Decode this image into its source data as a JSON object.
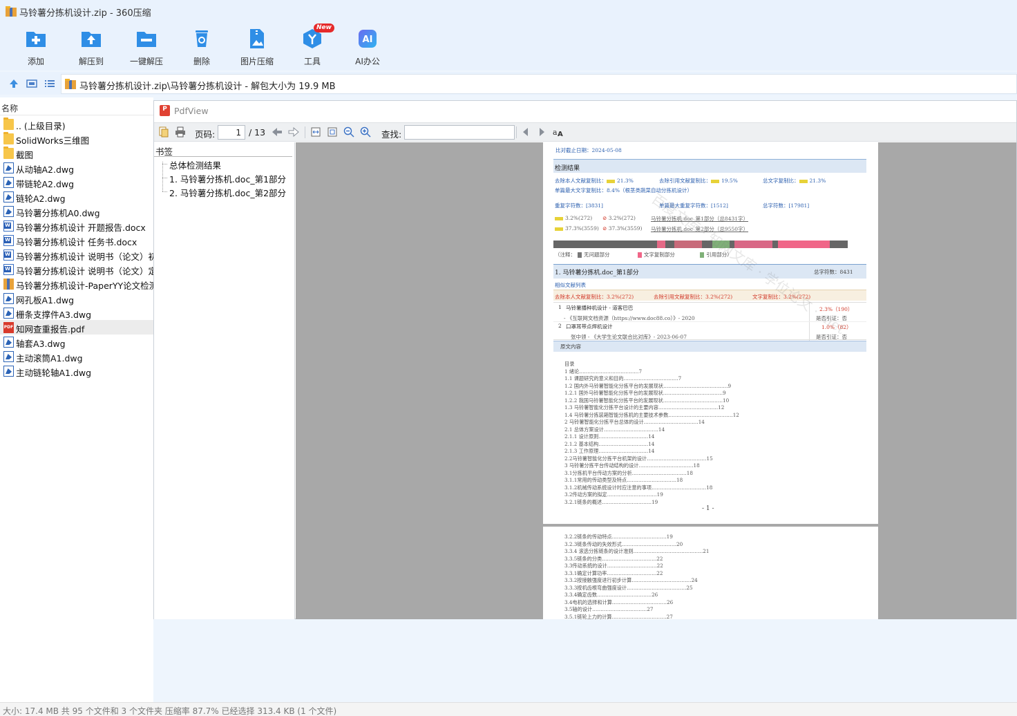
{
  "window": {
    "title": "马铃薯分拣机设计.zip - 360压缩"
  },
  "toolbar": {
    "buttons": [
      {
        "label": "添加",
        "icon": "add-icon"
      },
      {
        "label": "解压到",
        "icon": "extract-to-icon"
      },
      {
        "label": "一键解压",
        "icon": "one-click-extract-icon"
      },
      {
        "label": "删除",
        "icon": "delete-icon"
      },
      {
        "label": "图片压缩",
        "icon": "image-compress-icon"
      },
      {
        "label": "工具",
        "icon": "tools-icon",
        "badge": "New"
      },
      {
        "label": "AI办公",
        "icon": "ai-office-icon"
      }
    ]
  },
  "address": {
    "path": "马铃薯分拣机设计.zip\\马铃薯分拣机设计 - 解包大小为 19.9 MB"
  },
  "filelist": {
    "column_name": "名称",
    "items": [
      {
        "name": ".. (上级目录)",
        "type": "folder"
      },
      {
        "name": "SolidWorks三维图",
        "type": "folder"
      },
      {
        "name": "截图",
        "type": "folder"
      },
      {
        "name": "从动轴A2.dwg",
        "type": "dwg"
      },
      {
        "name": "带链轮A2.dwg",
        "type": "dwg"
      },
      {
        "name": "链轮A2.dwg",
        "type": "dwg"
      },
      {
        "name": "马铃薯分拣机A0.dwg",
        "type": "dwg"
      },
      {
        "name": "马铃薯分拣机设计 开题报告.docx",
        "type": "doc"
      },
      {
        "name": "马铃薯分拣机设计 任务书.docx",
        "type": "doc"
      },
      {
        "name": "马铃薯分拣机设计 说明书（论文）初稿",
        "type": "doc"
      },
      {
        "name": "马铃薯分拣机设计 说明书（论文）定稿",
        "type": "doc"
      },
      {
        "name": "马铃薯分拣机设计-PaperYY论文检测报告",
        "type": "zip"
      },
      {
        "name": "网孔板A1.dwg",
        "type": "dwg"
      },
      {
        "name": "栅条支撑件A3.dwg",
        "type": "dwg"
      },
      {
        "name": "知网查重报告.pdf",
        "type": "pdf",
        "selected": true
      },
      {
        "name": "轴套A3.dwg",
        "type": "dwg"
      },
      {
        "name": "主动滚筒A1.dwg",
        "type": "dwg"
      },
      {
        "name": "主动链轮轴A1.dwg",
        "type": "dwg"
      }
    ]
  },
  "pdfview": {
    "title": "PdfView",
    "page_label": "页码:",
    "page_current": "1",
    "page_total": "/ 13",
    "find_label": "查找:",
    "bookmarks_title": "书签",
    "bookmarks": [
      "总体检测结果",
      "1. 马铃薯分拣机.doc_第1部分",
      "2. 马铃薯分拣机.doc_第2部分"
    ]
  },
  "report": {
    "date": "比对截止日期：2024-05-08",
    "section_title": "检测结果",
    "stat1_label": "去除本人文献复制比：",
    "stat1_val": "21.3%",
    "stat2_label": "去除引用文献复制比：",
    "stat2_val": "19.5%",
    "stat3_label": "总文字复制比：",
    "stat3_val": "21.3%",
    "single_max": "单篇最大文字复制比：8.4%（根茎类蔬菜自动分拣机设计）",
    "dup_chars": "重复字符数：[3831]",
    "single_max_chars": "单篇最大重复字符数：[1512]",
    "total_chars": "总字符数：[17981]",
    "part_row1_a": "3.2%(272)",
    "part_row1_b": "3.2%(272)",
    "part_row1_name": "马铃薯分拣机.doc_第1部分（总8431字）",
    "part_row2_a": "37.3%(3559)",
    "part_row2_b": "37.3%(3559)",
    "part_row2_name": "马铃薯分拣机.doc_第2部分（总9550字）",
    "legend_note": "（注释：",
    "legend_none": "无问题部分",
    "legend_copy": "文字复制部分",
    "legend_cite": "引用部分）",
    "part1_title": "1.  马铃薯分拣机.doc_第1部分",
    "part1_total": "总字符数：8431",
    "similar_list": "相似文献列表",
    "part1_stat1": "去除本人文献复制比：3.2%(272)",
    "part1_stat2": "去除引用文献复制比：3.2%(272)",
    "part1_stat3": "文字复制比：3.2%(272)",
    "ref1_idx": "1",
    "ref1_title": "马铃薯播种机设计 - 道客巴巴",
    "ref1_pct": "2.3%（190）",
    "ref1_src": "-  《互联网文档资源（https://www.doc88.co）》-  2020",
    "ref1_cite": "是否引证：否",
    "ref2_idx": "2",
    "ref2_title": "口罩耳带点焊机设计",
    "ref2_pct": "1.0%（82）",
    "ref2_src": "张中领 -  《大学生论文联合比对库》- 2023-06-07",
    "ref2_cite": "是否引证：否",
    "original_text": "原文内容",
    "toc_page1": [
      "目录",
      "1 绪论………………………………7",
      "1.1 课题研究的意义和目的……………………………7",
      "1.2 国内外马铃薯智能化分拣平台的发展现状…………………………………9",
      "1.2.1 国外马铃薯智能化分拣平台的发展现状………………………………9",
      "1.2.2 我国马铃薯智能化分拣平台的发展现状………………………………10",
      "1.3 马铃薯智能化分拣平台设计的主要内容………………………………12",
      "1.4 马铃薯分拣装箱智能分拣机的主要技术参数…………………………………12",
      "2 马铃薯智能化分拣平台总体的设计……………………………14",
      "2.1 总体方案设计……………………………14",
      "2.1.1 设计原则…………………………14",
      "2.1.2 基本结构…………………………14",
      "2.1.3 工作原理…………………………14",
      "2.2马铃薯智能化分拣平台机架的设计………………………………15",
      "3 马铃薯分拣平台传动结构的设计……………………………18",
      "3.1分拣机平台传动方案的分析……………………………18",
      "3.1.1常用的传动类型及特点…………………………18",
      "3.1.2机械传动系统设计时应注意的事项……………………………18",
      "3.2传动方案的拟定…………………………19",
      "3.2.1链条的概述…………………………19"
    ],
    "page1_number": "- 1 -",
    "toc_page2": [
      "3.2.2链条的传动特点……………………………19",
      "3.2.3链条传动的失效形式……………………………20",
      "3.3.4 滚选分拣链条的设计准则……………………………………21",
      "3.3.5链条的分类……………………………22",
      "3.3传动系统的设计…………………………22",
      "3.3.1确定计算功率…………………………22",
      "3.3.2按接触强度进行初步计算………………………………24",
      "3.3.3按机齿根弯曲强度设计………………………………25",
      "3.3.4确定齿数……………………………26",
      "3.4电机的选择和计算……………………………26",
      "3.5轴的设计……………………………27",
      "3.5.1链轮上力的计算……………………………27"
    ],
    "watermark": "百度文库 · 知网文库 · 学位论文 · .net"
  },
  "status": {
    "text": "大小: 17.4 MB 共 95 个文件和 3 个文件夹 压缩率 87.7% 已经选择 313.4 KB (1 个文件)"
  },
  "colors": {
    "accent": "#2f8ee6",
    "chrome": "#e9f2fd",
    "report_blue": "#2f62b0",
    "report_red": "#d23a2a"
  }
}
